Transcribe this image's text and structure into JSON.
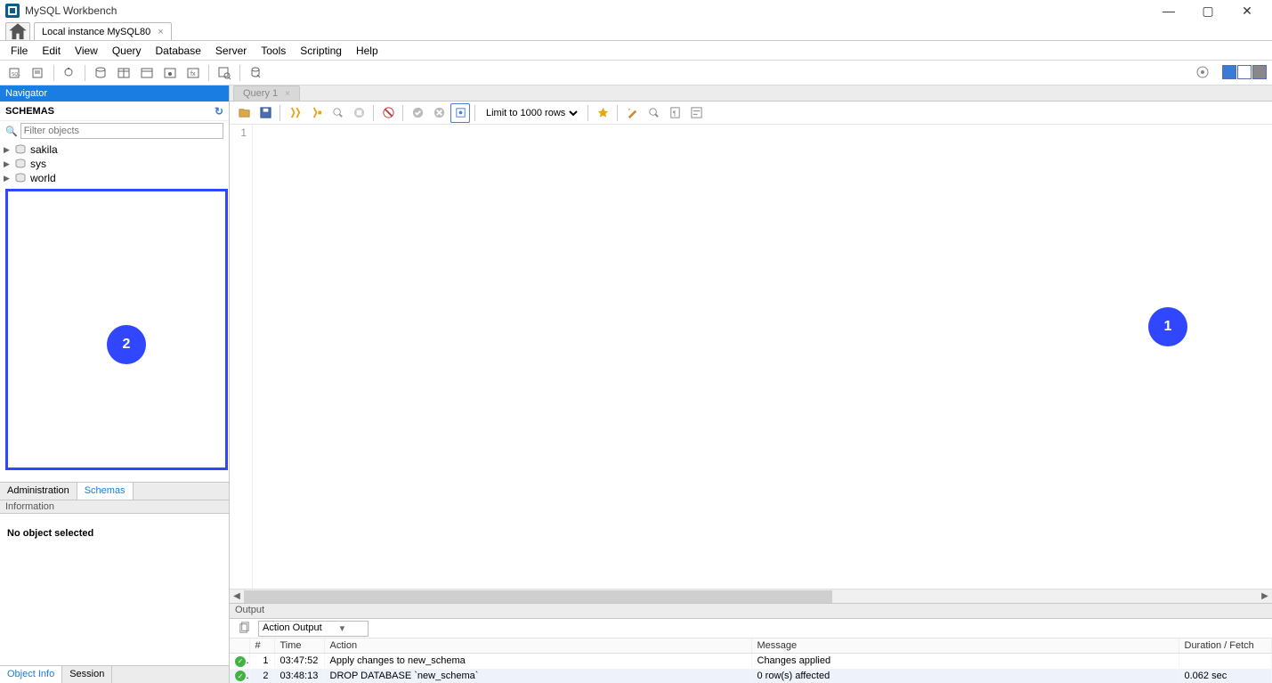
{
  "app": {
    "title": "MySQL Workbench"
  },
  "connection_tab": {
    "label": "Local instance MySQL80"
  },
  "menu": [
    "File",
    "Edit",
    "View",
    "Query",
    "Database",
    "Server",
    "Tools",
    "Scripting",
    "Help"
  ],
  "navigator": {
    "title": "Navigator",
    "section": "SCHEMAS",
    "filter_placeholder": "Filter objects",
    "schemas": [
      "sakila",
      "sys",
      "world"
    ],
    "subtabs": {
      "admin": "Administration",
      "schemas": "Schemas"
    }
  },
  "info_panel": {
    "title": "Information",
    "body": "No object selected"
  },
  "bottom_tabs": {
    "obj": "Object Info",
    "session": "Session"
  },
  "query": {
    "tab_label": "Query 1",
    "limit_label": "Limit to 1000 rows",
    "gutter_1": "1"
  },
  "output": {
    "title": "Output",
    "selector": "Action Output",
    "headers": {
      "num": "#",
      "time": "Time",
      "action": "Action",
      "message": "Message",
      "duration": "Duration / Fetch"
    },
    "rows": [
      {
        "num": "1",
        "time": "03:47:52",
        "action": "Apply changes to new_schema",
        "message": "Changes applied",
        "duration": ""
      },
      {
        "num": "2",
        "time": "03:48:13",
        "action": "DROP DATABASE `new_schema`",
        "message": "0 row(s) affected",
        "duration": "0.062 sec"
      }
    ]
  },
  "annotations": {
    "one": "1",
    "two": "2"
  }
}
